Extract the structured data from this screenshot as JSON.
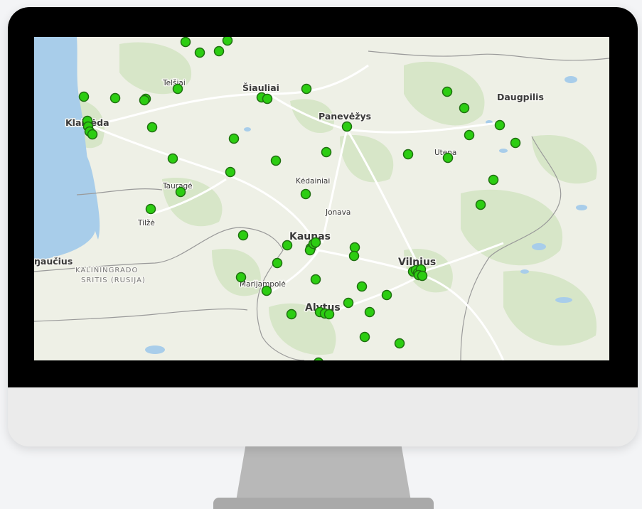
{
  "map": {
    "colors": {
      "land": "#eef0e6",
      "sea": "#a8cdea",
      "forest": "#d7e6c8",
      "border": "#9a9a9a",
      "road": "#ffffff",
      "marker": "#2ccd12",
      "marker_stroke": "#1f6f10"
    },
    "labels": {
      "klaipeda": "Klaipėda",
      "siauliai": "Šiauliai",
      "panevezys": "Panevėžys",
      "daugpilis": "Daugpilis",
      "telsiai": "Telšiai",
      "taurage": "Tauragė",
      "kedainiai": "Kėdainiai",
      "jonava": "Jonava",
      "utena": "Utena",
      "tilze": "Tilžė",
      "kaunas": "Kaunas",
      "vilnius": "Vilnius",
      "marijampole": "Marijampolė",
      "alytus": "Alytus",
      "gusev": "ŋaučius",
      "region_line1": "KALININGRADO",
      "region_line2": "SRITIS (RUSIJA)"
    },
    "marker_icon": "location-dot-icon"
  }
}
